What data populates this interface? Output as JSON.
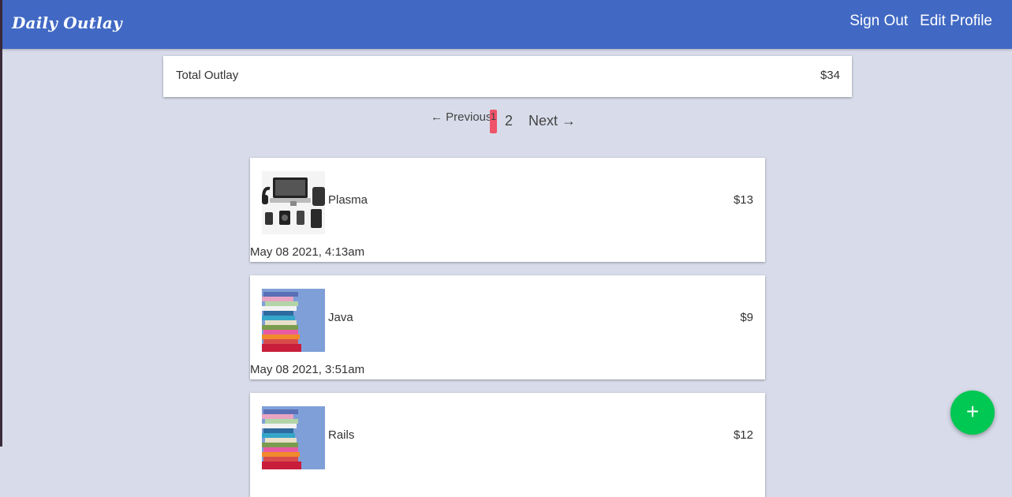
{
  "header": {
    "brand": "Daily Outlay",
    "nav": {
      "sign_out": "Sign Out",
      "edit_profile": "Edit Profile"
    }
  },
  "summary": {
    "label": "Total Outlay",
    "value": "$34"
  },
  "pagination": {
    "previous": "← Previous",
    "current_page": "1",
    "pages": [
      "2"
    ],
    "next": "Next →"
  },
  "expenses": [
    {
      "name": "Plasma",
      "amount": "$13",
      "date": "May 08 2021, 4:13am",
      "image": "electronics-image"
    },
    {
      "name": "Java",
      "amount": "$9",
      "date": "May 08 2021, 3:51am",
      "image": "books-image"
    },
    {
      "name": "Rails",
      "amount": "$12",
      "image": "books-image"
    }
  ],
  "fab": {
    "label": "+"
  }
}
